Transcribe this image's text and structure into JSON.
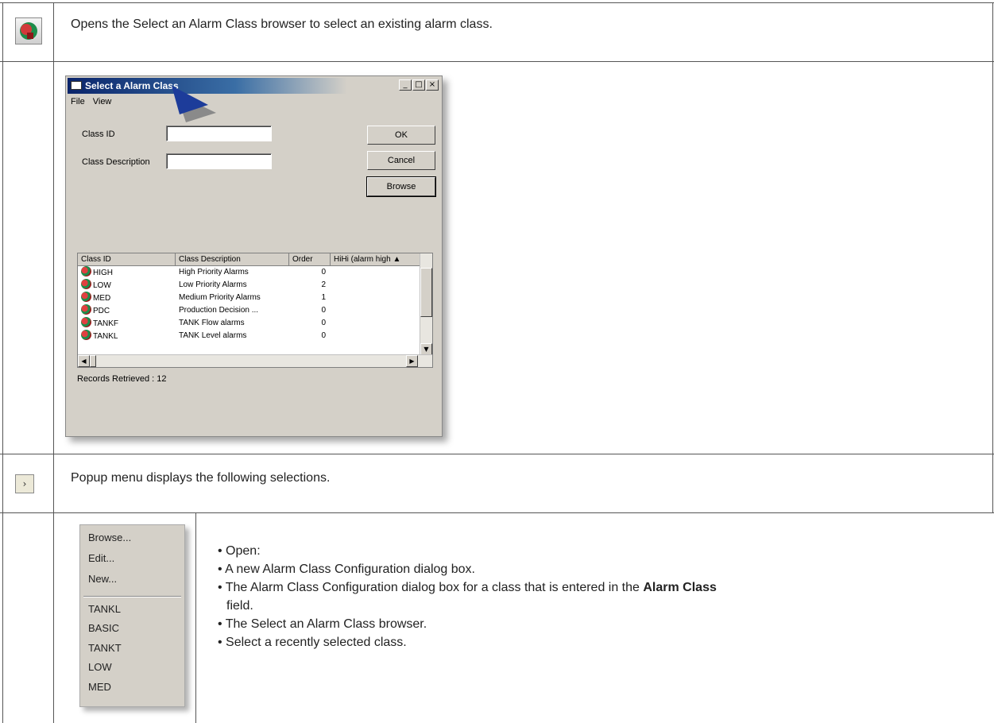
{
  "row1": {
    "text": "Opens the Select an Alarm Class browser to select an existing alarm class."
  },
  "dialog": {
    "title": "Select a Alarm Class",
    "menu": [
      "File",
      "View"
    ],
    "class_id_label": "Class ID",
    "class_desc_label": "Class Description",
    "ok": "OK",
    "cancel": "Cancel",
    "browse": "Browse",
    "window_buttons": [
      "_",
      "□",
      "×"
    ],
    "columns": [
      "Class ID",
      "Class Description",
      "Order",
      "HiHi (alarm high ▲"
    ],
    "rows": [
      {
        "id": "HIGH",
        "desc": "High Priority Alarms",
        "order": "0"
      },
      {
        "id": "LOW",
        "desc": "Low Priority Alarms",
        "order": "2"
      },
      {
        "id": "MED",
        "desc": "Medium Priority Alarms",
        "order": "1"
      },
      {
        "id": "PDC",
        "desc": "Production Decision ...",
        "order": "0"
      },
      {
        "id": "TANKF",
        "desc": "TANK Flow alarms",
        "order": "0"
      },
      {
        "id": "TANKL",
        "desc": "TANK Level alarms",
        "order": "0"
      }
    ],
    "records": "Records Retrieved : 12"
  },
  "row3": {
    "text": "Popup menu displays the following selections.",
    "button_glyph": "›"
  },
  "popup": {
    "items": [
      "Browse...",
      "Edit...",
      "New..."
    ],
    "recent": [
      "TANKL",
      "BASIC",
      "TANKT",
      "LOW",
      "MED"
    ]
  },
  "bullets": {
    "b1": "• Open:",
    "b2": "• A new Alarm Class Configuration dialog box.",
    "b3_pre": "• The Alarm Class Configuration dialog box for a class that is entered in the ",
    "b3_bold": "Alarm Class",
    "b3_post": "field.",
    "b4": "• The Select an Alarm Class browser.",
    "b5": "• Select a recently selected class."
  },
  "colors": {
    "border": "#555555",
    "dialog_bg": "#d4d0c8",
    "title_blue": "#0a246a"
  }
}
